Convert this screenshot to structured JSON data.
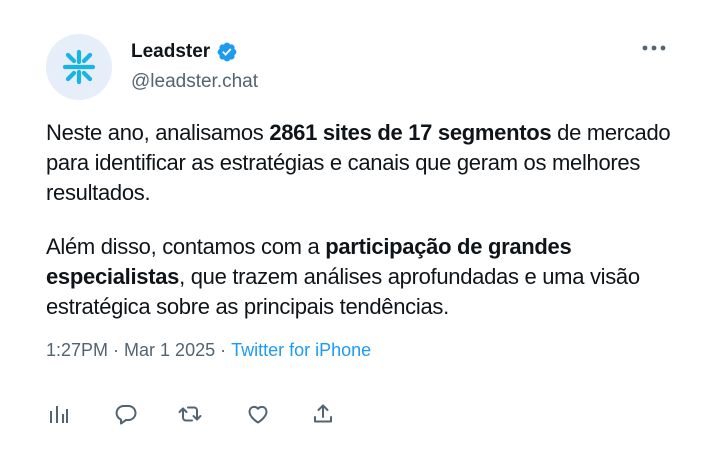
{
  "author": {
    "display_name": "Leadster",
    "handle": "@leadster.chat",
    "verified": true,
    "avatar_icon": "leadster-logo-icon"
  },
  "tweet": {
    "p1_a": "Neste ano, analisamos ",
    "p1_bold": "2861 sites de 17 segmentos",
    "p1_b": " de mercado para identificar as estratégias e canais que geram os melhores resultados.",
    "p2_a": "Além disso, contamos com a ",
    "p2_bold": "participação de grandes especialistas",
    "p2_b": ", que trazem análises aprofundadas e uma visão estratégica sobre as principais tendências."
  },
  "meta": {
    "time": "1:27PM",
    "date": "Mar 1 2025",
    "separator": "·",
    "source": "Twitter for iPhone"
  },
  "actions": [
    "analytics-icon",
    "reply-icon",
    "retweet-icon",
    "like-icon",
    "share-icon"
  ],
  "colors": {
    "text": "#0f1419",
    "secondary": "#536471",
    "accent": "#1d9bf0",
    "avatar_bg": "#e6eef9"
  }
}
